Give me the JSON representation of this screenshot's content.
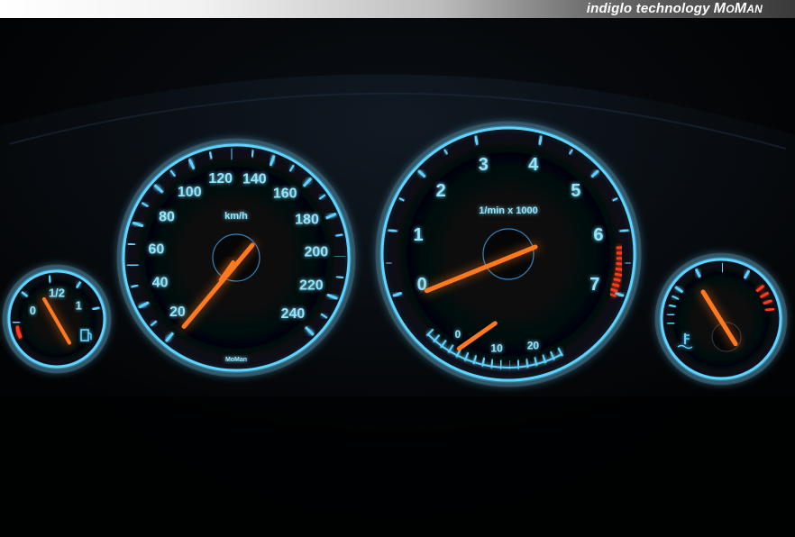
{
  "header": {
    "tagline": "indiglo technology",
    "brand_big_1": "M",
    "brand_small_1": "O",
    "brand_big_2": "M",
    "brand_small_2": "AN"
  },
  "colors": {
    "glow": "#5fd3ff",
    "text": "#8fe6ff",
    "needle": "#ff7a1e",
    "redzone": "#ff3b1f"
  },
  "speedometer": {
    "labels": [
      "20",
      "40",
      "60",
      "80",
      "100",
      "120",
      "140",
      "160",
      "180",
      "200",
      "220",
      "240"
    ],
    "unit": "km/h",
    "maker": "MoMan"
  },
  "tachometer": {
    "labels": [
      "0",
      "1",
      "2",
      "3",
      "4",
      "5",
      "6",
      "7"
    ],
    "unit": "1/min x 1000",
    "sub_labels": [
      "0",
      "10",
      "20"
    ]
  },
  "fuel_gauge": {
    "labels": [
      "0",
      "1/2",
      "1"
    ],
    "icon": "fuel-pump-icon"
  },
  "temp_gauge": {
    "icon": "coolant-temperature-icon"
  }
}
